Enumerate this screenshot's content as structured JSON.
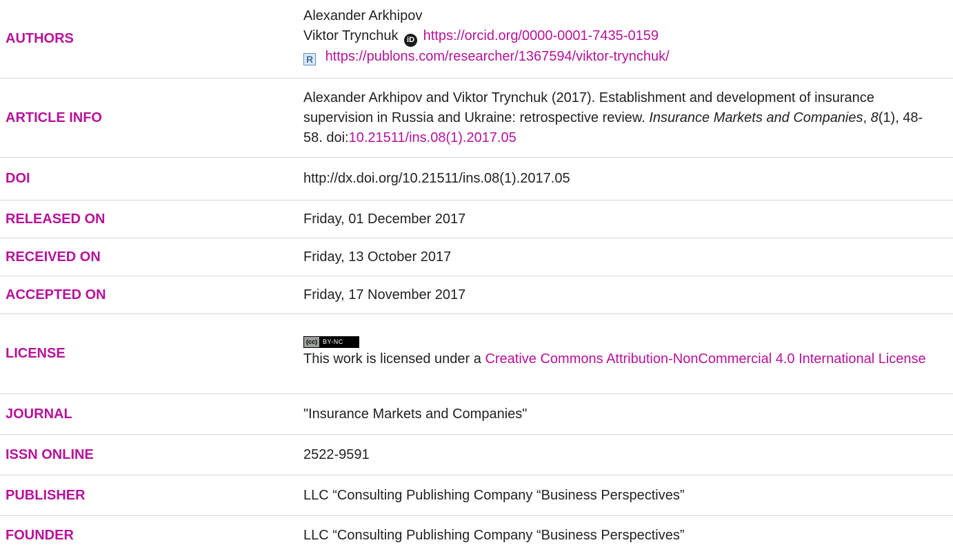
{
  "authors": {
    "label": "AUTHORS",
    "author1": "Alexander Arkhipov",
    "author2": "Viktor Trynchuk",
    "orcid_icon": "orcid-icon",
    "orcid_url": "https://orcid.org/0000-0001-7435-0159",
    "publons_icon": "publons-icon",
    "publons_url": "https://publons.com/researcher/1367594/viktor-trynchuk/"
  },
  "article_info": {
    "label": "ARTICLE INFO",
    "citation_pre": "Alexander Arkhipov and Viktor Trynchuk (2017). Establishment and development of insurance supervision in Russia and Ukraine: retrospective review. ",
    "journal_italic": "Insurance Markets and Companies",
    "comma": ", ",
    "volume_italic": "8",
    "citation_post": "(1), 48-58. doi:",
    "doi_link": "10.21511/ins.08(1).2017.05"
  },
  "doi": {
    "label": "DOI",
    "value": "http://dx.doi.org/10.21511/ins.08(1).2017.05"
  },
  "released": {
    "label": "RELEASED ON",
    "value": "Friday, 01 December 2017"
  },
  "received": {
    "label": "RECEIVED ON",
    "value": "Friday, 13 October 2017"
  },
  "accepted": {
    "label": "ACCEPTED ON",
    "value": "Friday, 17 November 2017"
  },
  "license": {
    "label": "LICENSE",
    "badge_left": "(cc)",
    "badge_right": "BY-NC",
    "text": "This work is licensed under a ",
    "link": "Creative Commons Attribution-NonCommercial 4.0 International License"
  },
  "journal": {
    "label": "JOURNAL",
    "value": "\"Insurance Markets and Companies\""
  },
  "issn": {
    "label": "ISSN ONLINE",
    "value": "2522-9591"
  },
  "publisher": {
    "label": "PUBLISHER",
    "value": "LLC “Consulting Publishing Company “Business Perspectives”"
  },
  "founder": {
    "label": "FOUNDER",
    "value": "LLC “Consulting Publishing Company “Business Perspectives”"
  },
  "colors": {
    "label_accent": "#b8129b",
    "text": "#222222",
    "divider": "#d6d6d6"
  }
}
